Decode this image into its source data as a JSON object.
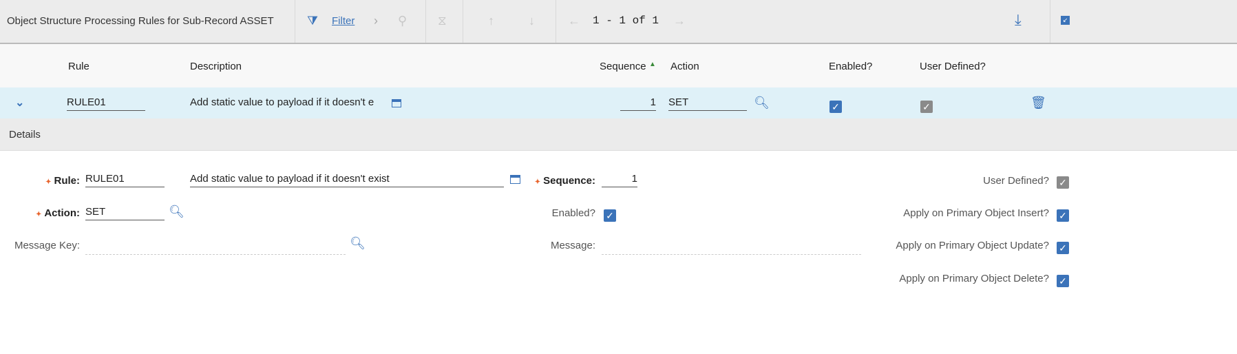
{
  "toolbar": {
    "title": "Object Structure Processing Rules for Sub-Record ASSET",
    "filter_label": "Filter",
    "pagination": "1 - 1 of 1"
  },
  "columns": {
    "rule": "Rule",
    "description": "Description",
    "sequence": "Sequence",
    "action": "Action",
    "enabled": "Enabled?",
    "user_defined": "User Defined?"
  },
  "row": {
    "rule": "RULE01",
    "description": "Add static value to payload if it doesn't e",
    "sequence": "1",
    "action": "SET",
    "enabled": true,
    "user_defined": true
  },
  "details": {
    "title": "Details",
    "rule_label": "Rule:",
    "rule": "RULE01",
    "description": "Add static value to payload if it doesn't exist",
    "sequence_label": "Sequence:",
    "sequence": "1",
    "action_label": "Action:",
    "action": "SET",
    "message_key_label": "Message Key:",
    "message_key": "",
    "enabled_label": "Enabled?",
    "message_label": "Message:",
    "message": "",
    "user_defined_label": "User Defined?",
    "insert_label": "Apply on Primary Object Insert?",
    "update_label": "Apply on Primary Object Update?",
    "delete_label": "Apply on Primary Object Delete?"
  }
}
